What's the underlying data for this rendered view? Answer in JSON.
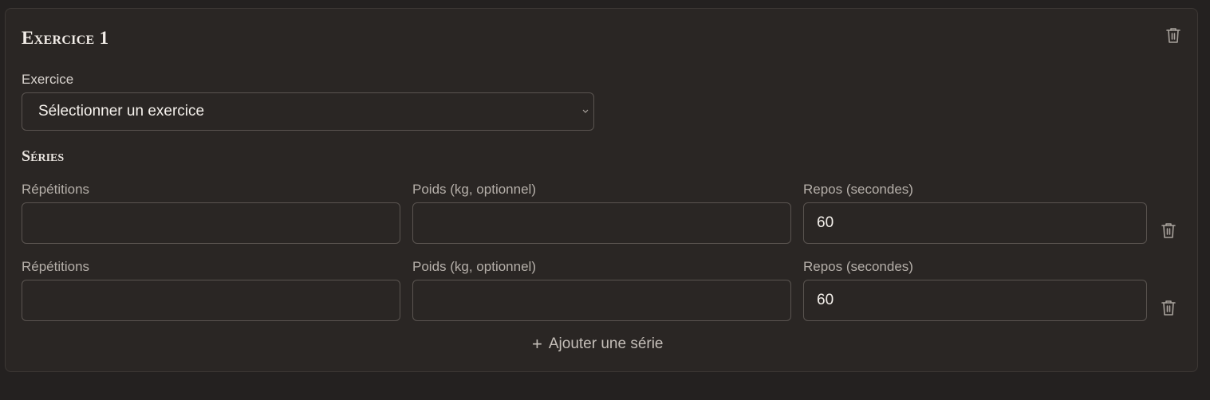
{
  "exercise_card": {
    "title": "Exercice 1",
    "exercise_field": {
      "label": "Exercice",
      "selected_value": "Sélectionner un exercice"
    },
    "series_section": {
      "title": "Séries",
      "rows": [
        {
          "reps_label": "Répétitions",
          "reps_value": "",
          "weight_label": "Poids (kg, optionnel)",
          "weight_value": "",
          "rest_label": "Repos (secondes)",
          "rest_value": "60"
        },
        {
          "reps_label": "Répétitions",
          "reps_value": "",
          "weight_label": "Poids (kg, optionnel)",
          "weight_value": "",
          "rest_label": "Repos (secondes)",
          "rest_value": "60"
        }
      ],
      "add_series_label": "Ajouter une série",
      "add_series_icon": "plus-icon"
    },
    "delete_icon": "trash-icon"
  },
  "colors": {
    "background": "#242120",
    "card": "#2a2624",
    "border": "#5a5450",
    "text": "#f5f1ec",
    "muted": "#b5afa9"
  }
}
